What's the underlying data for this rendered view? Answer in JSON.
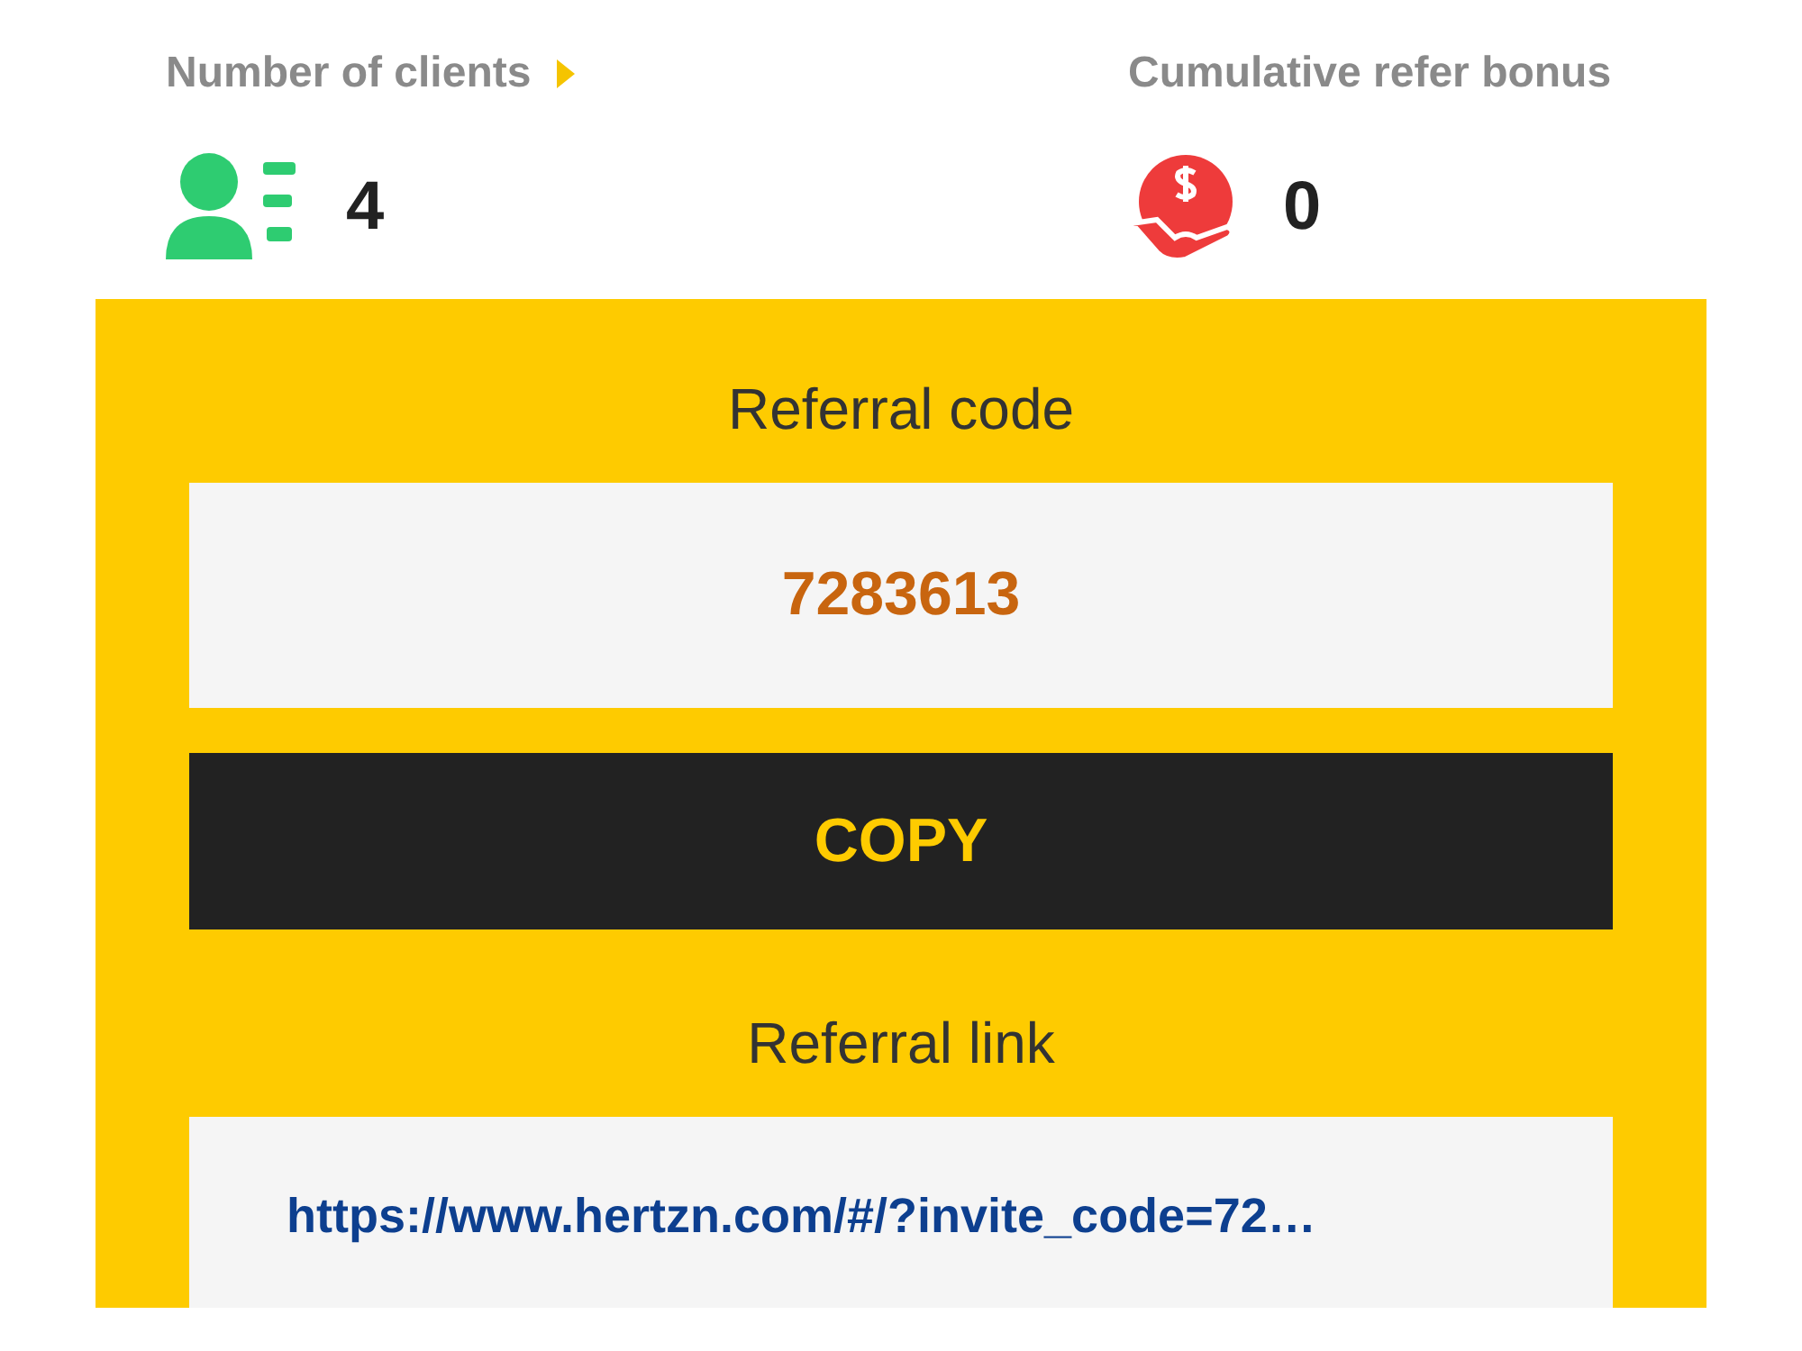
{
  "stats": [
    {
      "kind": "clients",
      "label": "Number of clients",
      "has_more": true,
      "value": "4"
    },
    {
      "kind": "bonus",
      "label": "Cumulative refer bonus",
      "has_more": false,
      "value": "0"
    }
  ],
  "referral": {
    "code_title": "Referral code",
    "code": "7283613",
    "copy_button": "COPY",
    "link_title": "Referral link",
    "link": "https://www.hertzn.com/#/?invite_code=72…"
  }
}
